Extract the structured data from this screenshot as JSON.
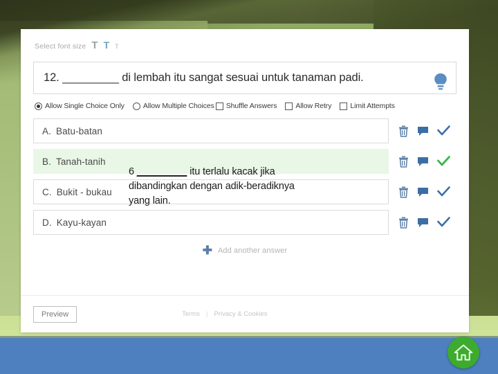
{
  "editor": {
    "font_size_label": "Select font size",
    "font_size_options": [
      {
        "name": "font-size-large",
        "glyph": "T"
      },
      {
        "name": "font-size-medium",
        "glyph": "T"
      },
      {
        "name": "font-size-small",
        "glyph": "T"
      }
    ],
    "question": "12. _________ di lembah itu sangat sesuai untuk tanaman padi.",
    "hint_icon": "lightbulb-icon",
    "settings": [
      {
        "type": "radio",
        "label": "Allow Single Choice Only",
        "checked": true
      },
      {
        "type": "radio",
        "label": "Allow Multiple Choices",
        "checked": false
      },
      {
        "type": "checkbox",
        "label": "Shuffle Answers",
        "checked": false
      },
      {
        "type": "checkbox",
        "label": "Allow Retry",
        "checked": false
      },
      {
        "type": "checkbox",
        "label": "Limit Attempts",
        "checked": false
      }
    ],
    "answers": [
      {
        "letter": "A.",
        "text": "Batu-batan",
        "correct": false
      },
      {
        "letter": "B.",
        "text": "Tanah-tanih",
        "correct": true
      },
      {
        "letter": "C.",
        "text": "Bukit - bukau",
        "correct": false
      },
      {
        "letter": "D.",
        "text": "Kayu-kayan",
        "correct": false
      }
    ],
    "row_actions": [
      "delete-icon",
      "comment-icon",
      "correct-check-icon"
    ],
    "add_answer_label": "Add another answer",
    "add_answer_icon": "plus-icon"
  },
  "footer": {
    "preview_label": "Preview",
    "terms_label": "Terms",
    "separator": "|",
    "privacy_label": "Privacy & Cookies"
  },
  "overlay": {
    "line1_prefix": "6 ",
    "line1_blank": "_________",
    "line1_suffix": " itu terlalu kacak jika",
    "line2": "dibandingkan dengan adik-beradiknya",
    "line3": "yang lain."
  },
  "nav": {
    "home_icon": "home-icon"
  },
  "colors": {
    "accent_blue": "#4e80bf",
    "correct_green": "#3cb54a",
    "home_green": "#3cab2e",
    "highlight_row": "#e9f7e6",
    "icon_blue": "#5b7fa6"
  }
}
